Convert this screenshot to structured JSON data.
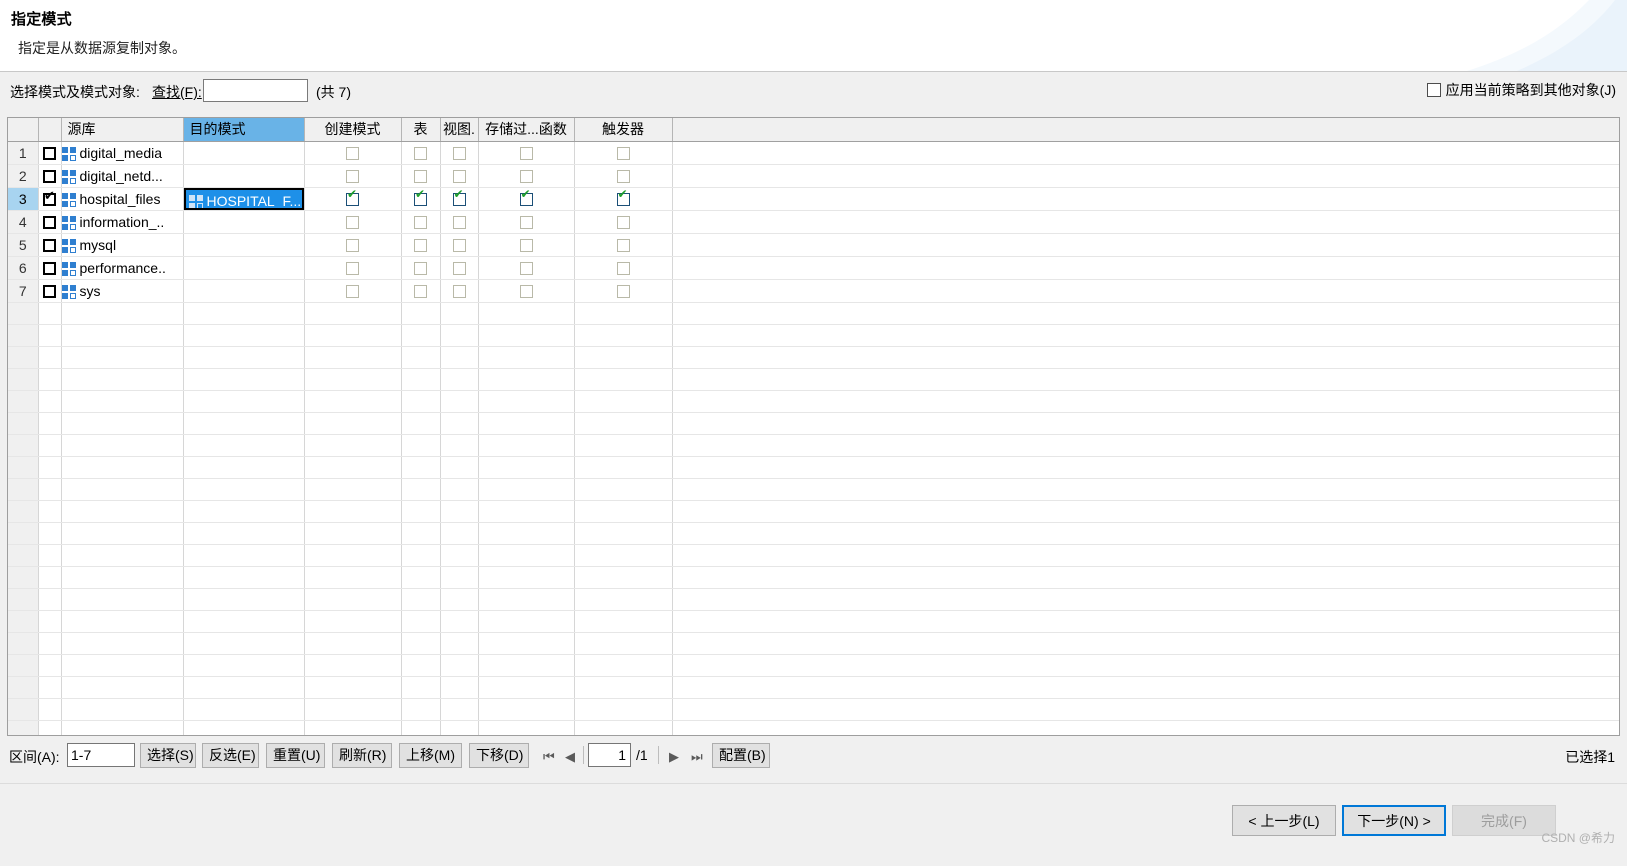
{
  "header": {
    "title": "指定模式",
    "subtitle": "指定是从数据源复制对象。"
  },
  "searchbar": {
    "label": "选择模式及模式对象:",
    "find_label": "查找(F):",
    "find_value": "",
    "find_placeholder": "",
    "count_text": "(共 7)",
    "apply_policy_label": "应用当前策略到其他对象(J)",
    "apply_policy_checked": false
  },
  "grid": {
    "columns": [
      {
        "key": "rownum",
        "label": ""
      },
      {
        "key": "check",
        "label": ""
      },
      {
        "key": "source",
        "label": "源库"
      },
      {
        "key": "target",
        "label": "目的模式",
        "selected": true
      },
      {
        "key": "create",
        "label": "创建模式"
      },
      {
        "key": "table",
        "label": "表"
      },
      {
        "key": "view",
        "label": "视图."
      },
      {
        "key": "proc",
        "label": "存储过...函数"
      },
      {
        "key": "trigger",
        "label": "触发器"
      }
    ],
    "rows": [
      {
        "num": "1",
        "checked": false,
        "source": "digital_media",
        "target": "",
        "create": false,
        "table": false,
        "view": false,
        "proc": false,
        "trigger": false,
        "selected": false
      },
      {
        "num": "2",
        "checked": false,
        "source": "digital_netd...",
        "target": "",
        "create": false,
        "table": false,
        "view": false,
        "proc": false,
        "trigger": false,
        "selected": false
      },
      {
        "num": "3",
        "checked": true,
        "source": "hospital_files",
        "target": "HOSPITAL_F...",
        "create": true,
        "table": true,
        "view": true,
        "proc": true,
        "trigger": true,
        "selected": true
      },
      {
        "num": "4",
        "checked": false,
        "source": "information_..",
        "target": "",
        "create": false,
        "table": false,
        "view": false,
        "proc": false,
        "trigger": false,
        "selected": false
      },
      {
        "num": "5",
        "checked": false,
        "source": "mysql",
        "target": "",
        "create": false,
        "table": false,
        "view": false,
        "proc": false,
        "trigger": false,
        "selected": false
      },
      {
        "num": "6",
        "checked": false,
        "source": "performance..",
        "target": "",
        "create": false,
        "table": false,
        "view": false,
        "proc": false,
        "trigger": false,
        "selected": false
      },
      {
        "num": "7",
        "checked": false,
        "source": "sys",
        "target": "",
        "create": false,
        "table": false,
        "view": false,
        "proc": false,
        "trigger": false,
        "selected": false
      }
    ],
    "empty_row_count": 21
  },
  "toolbar": {
    "range_label": "区间(A):",
    "range_value": "1-7",
    "buttons": [
      {
        "name": "select",
        "label": "选择(S)"
      },
      {
        "name": "invert",
        "label": "反选(E)"
      },
      {
        "name": "reset",
        "label": "重置(U)"
      },
      {
        "name": "refresh",
        "label": "刷新(R)"
      },
      {
        "name": "moveup",
        "label": "上移(M)"
      },
      {
        "name": "movedown",
        "label": "下移(D)"
      }
    ],
    "nav": {
      "first": "⏮",
      "prev": "◀",
      "next": "▶",
      "last": "⏭"
    },
    "page_value": "1",
    "page_total": "/1",
    "config_label": "配置(B)",
    "selected_text": "已选择1"
  },
  "footer": {
    "prev_label": "< 上一步(L)",
    "next_label": "下一步(N) >",
    "finish_label": "完成(F)",
    "watermark": "CSDN @希力"
  },
  "colors": {
    "accent": "#0078d7",
    "header_selected": "#69b3e7",
    "cell_selected": "#1e90e8",
    "check_green": "#1d9e2a",
    "icon_blue": "#2f7fd0",
    "panel": "#f0f0f0"
  }
}
